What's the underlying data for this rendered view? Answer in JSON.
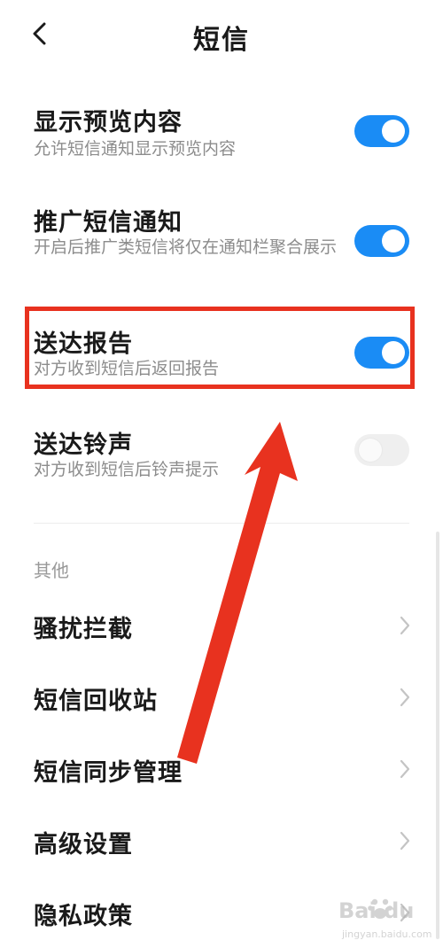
{
  "header": {
    "title": "短信"
  },
  "settings": [
    {
      "title": "显示预览内容",
      "subtitle": "允许短信通知显示预览内容",
      "enabled": true
    },
    {
      "title": "推广短信通知",
      "subtitle": "开启后推广类短信将仅在通知栏聚合展示",
      "enabled": true
    },
    {
      "title": "送达报告",
      "subtitle": "对方收到短信后返回报告",
      "enabled": true
    },
    {
      "title": "送达铃声",
      "subtitle": "对方收到短信后铃声提示",
      "enabled": false
    }
  ],
  "other_section": {
    "label": "其他",
    "items": [
      {
        "label": "骚扰拦截"
      },
      {
        "label": "短信回收站"
      },
      {
        "label": "短信同步管理"
      },
      {
        "label": "高级设置"
      },
      {
        "label": "隐私政策"
      }
    ]
  },
  "colors": {
    "toggle_on": "#1a8cf5",
    "toggle_off": "#efefef",
    "annotation_red": "#e8321f"
  },
  "icons": {
    "back": "chevron-left-icon",
    "item_arrow": "chevron-right-icon"
  },
  "watermark": {
    "brand": "Bai du",
    "sub": "jingyan.baidu.com"
  }
}
